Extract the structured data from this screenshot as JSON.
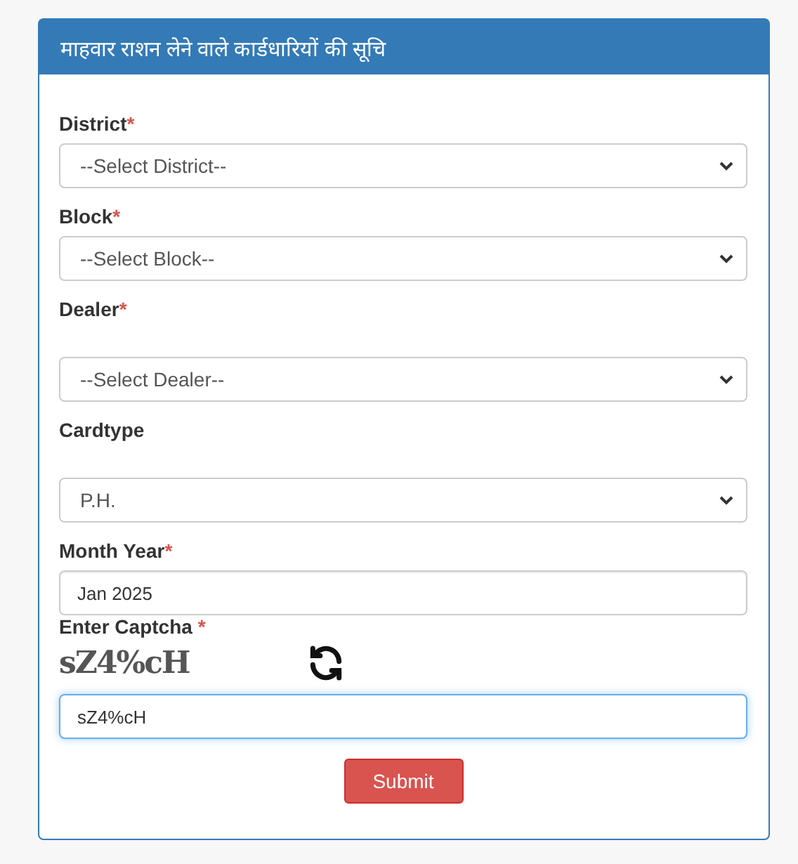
{
  "panel": {
    "title": "माहवार राशन लेने वाले कार्डधारियों की सूचि"
  },
  "fields": [
    {
      "kind": "select",
      "label": "District",
      "required_mark": "*",
      "value": "--Select District--"
    },
    {
      "kind": "select",
      "label": "Block",
      "required_mark": "*",
      "value": "--Select Block--"
    },
    {
      "kind": "select",
      "label": "Dealer",
      "required_mark": "*",
      "value": "--Select Dealer--"
    },
    {
      "kind": "select",
      "label": "Cardtype",
      "value": "P.H."
    },
    {
      "kind": "input",
      "label": "Month Year",
      "required_mark": "*",
      "value": "Jan 2025"
    }
  ],
  "captcha": {
    "label": "Enter Captcha",
    "required_mark": "*",
    "code": "sZ4%cH",
    "value": "sZ4%cH",
    "focused": true
  },
  "submit": "Submit"
}
